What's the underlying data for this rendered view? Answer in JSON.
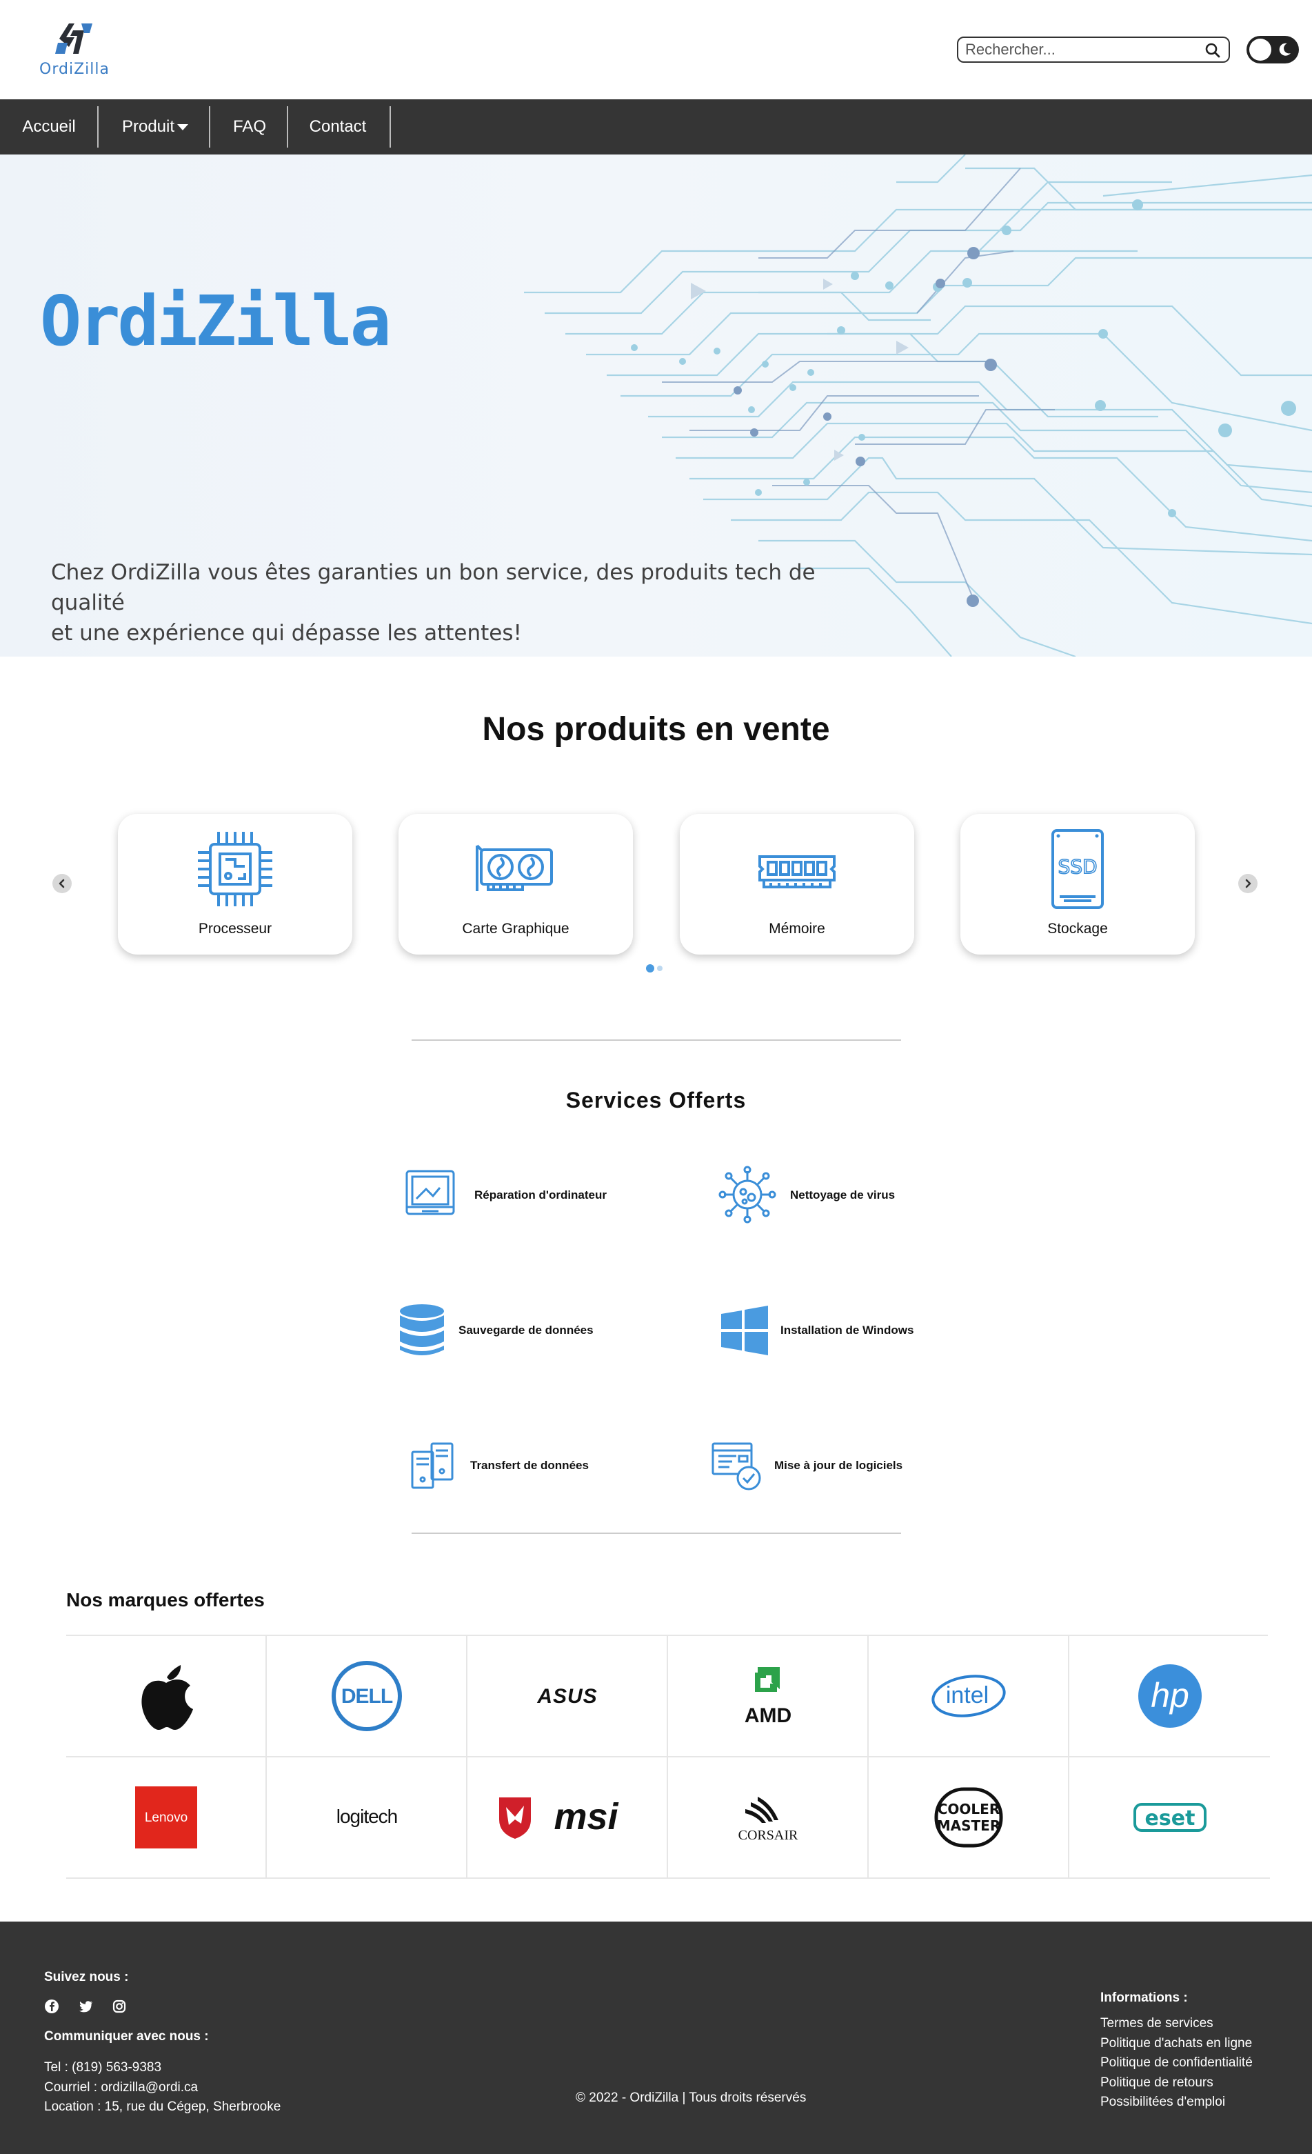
{
  "header": {
    "logo_text": "OrdiZilla",
    "search_placeholder": "Rechercher...",
    "colors": {
      "accent": "#3a7cc4",
      "nav_bg": "#353535"
    }
  },
  "nav": {
    "items": [
      {
        "label": "Accueil"
      },
      {
        "label": "Produit"
      },
      {
        "label": "FAQ"
      },
      {
        "label": "Contact"
      }
    ]
  },
  "hero": {
    "brand_title": "OrdiZilla",
    "description_line1": "Chez OrdiZilla vous êtes garanties un bon service, des produits tech de qualité",
    "description_line2": "et une expérience qui dépasse les attentes!"
  },
  "products": {
    "title": "Nos produits en vente",
    "cards": [
      {
        "label": "Processeur",
        "icon": "cpu-icon"
      },
      {
        "label": "Carte Graphique",
        "icon": "graphics-card-icon"
      },
      {
        "label": "Mémoire",
        "icon": "memory-icon"
      },
      {
        "label": "Stockage",
        "icon": "ssd-icon"
      }
    ],
    "active_page": 1,
    "page_count": 2
  },
  "services": {
    "title": "Services Offerts",
    "items": [
      {
        "label": "Réparation d'ordinateur",
        "icon": "computer-repair-icon"
      },
      {
        "label": "Nettoyage de virus",
        "icon": "virus-icon"
      },
      {
        "label": "Sauvegarde de données",
        "icon": "database-icon"
      },
      {
        "label": "Installation de Windows",
        "icon": "windows-icon"
      },
      {
        "label": "Transfert de données",
        "icon": "data-transfer-icon"
      },
      {
        "label": "Mise à jour de logiciels",
        "icon": "software-update-icon"
      }
    ]
  },
  "brands": {
    "title": "Nos marques offertes",
    "logos": {
      "dell": "DELL",
      "asus": "ASUS",
      "amd": "AMD",
      "intel": "intel",
      "hp": "hp",
      "lenovo": "Lenovo",
      "logitech": "logitech",
      "msi": "msi",
      "corsair": "CORSAIR",
      "cooler_master_1": "COOLER",
      "cooler_master_2": "MASTER",
      "eset": "eset"
    }
  },
  "footer": {
    "follow_title": "Suivez nous :",
    "contact_title": "Communiquer avec nous :",
    "tel": "Tel : (819) 563-9383",
    "email": "Courriel : ordizilla@ordi.ca",
    "location": "Location : 15, rue du Cégep, Sherbrooke",
    "copyright": "© 2022 - OrdiZilla | Tous droits réservés",
    "info_title": "Informations :",
    "info_links": [
      {
        "label": "Termes de services"
      },
      {
        "label": "Politique d'achats en ligne"
      },
      {
        "label": "Politique de confidentialité"
      },
      {
        "label": "Politique de retours"
      },
      {
        "label": "Possibilitées d'emploi"
      }
    ]
  }
}
